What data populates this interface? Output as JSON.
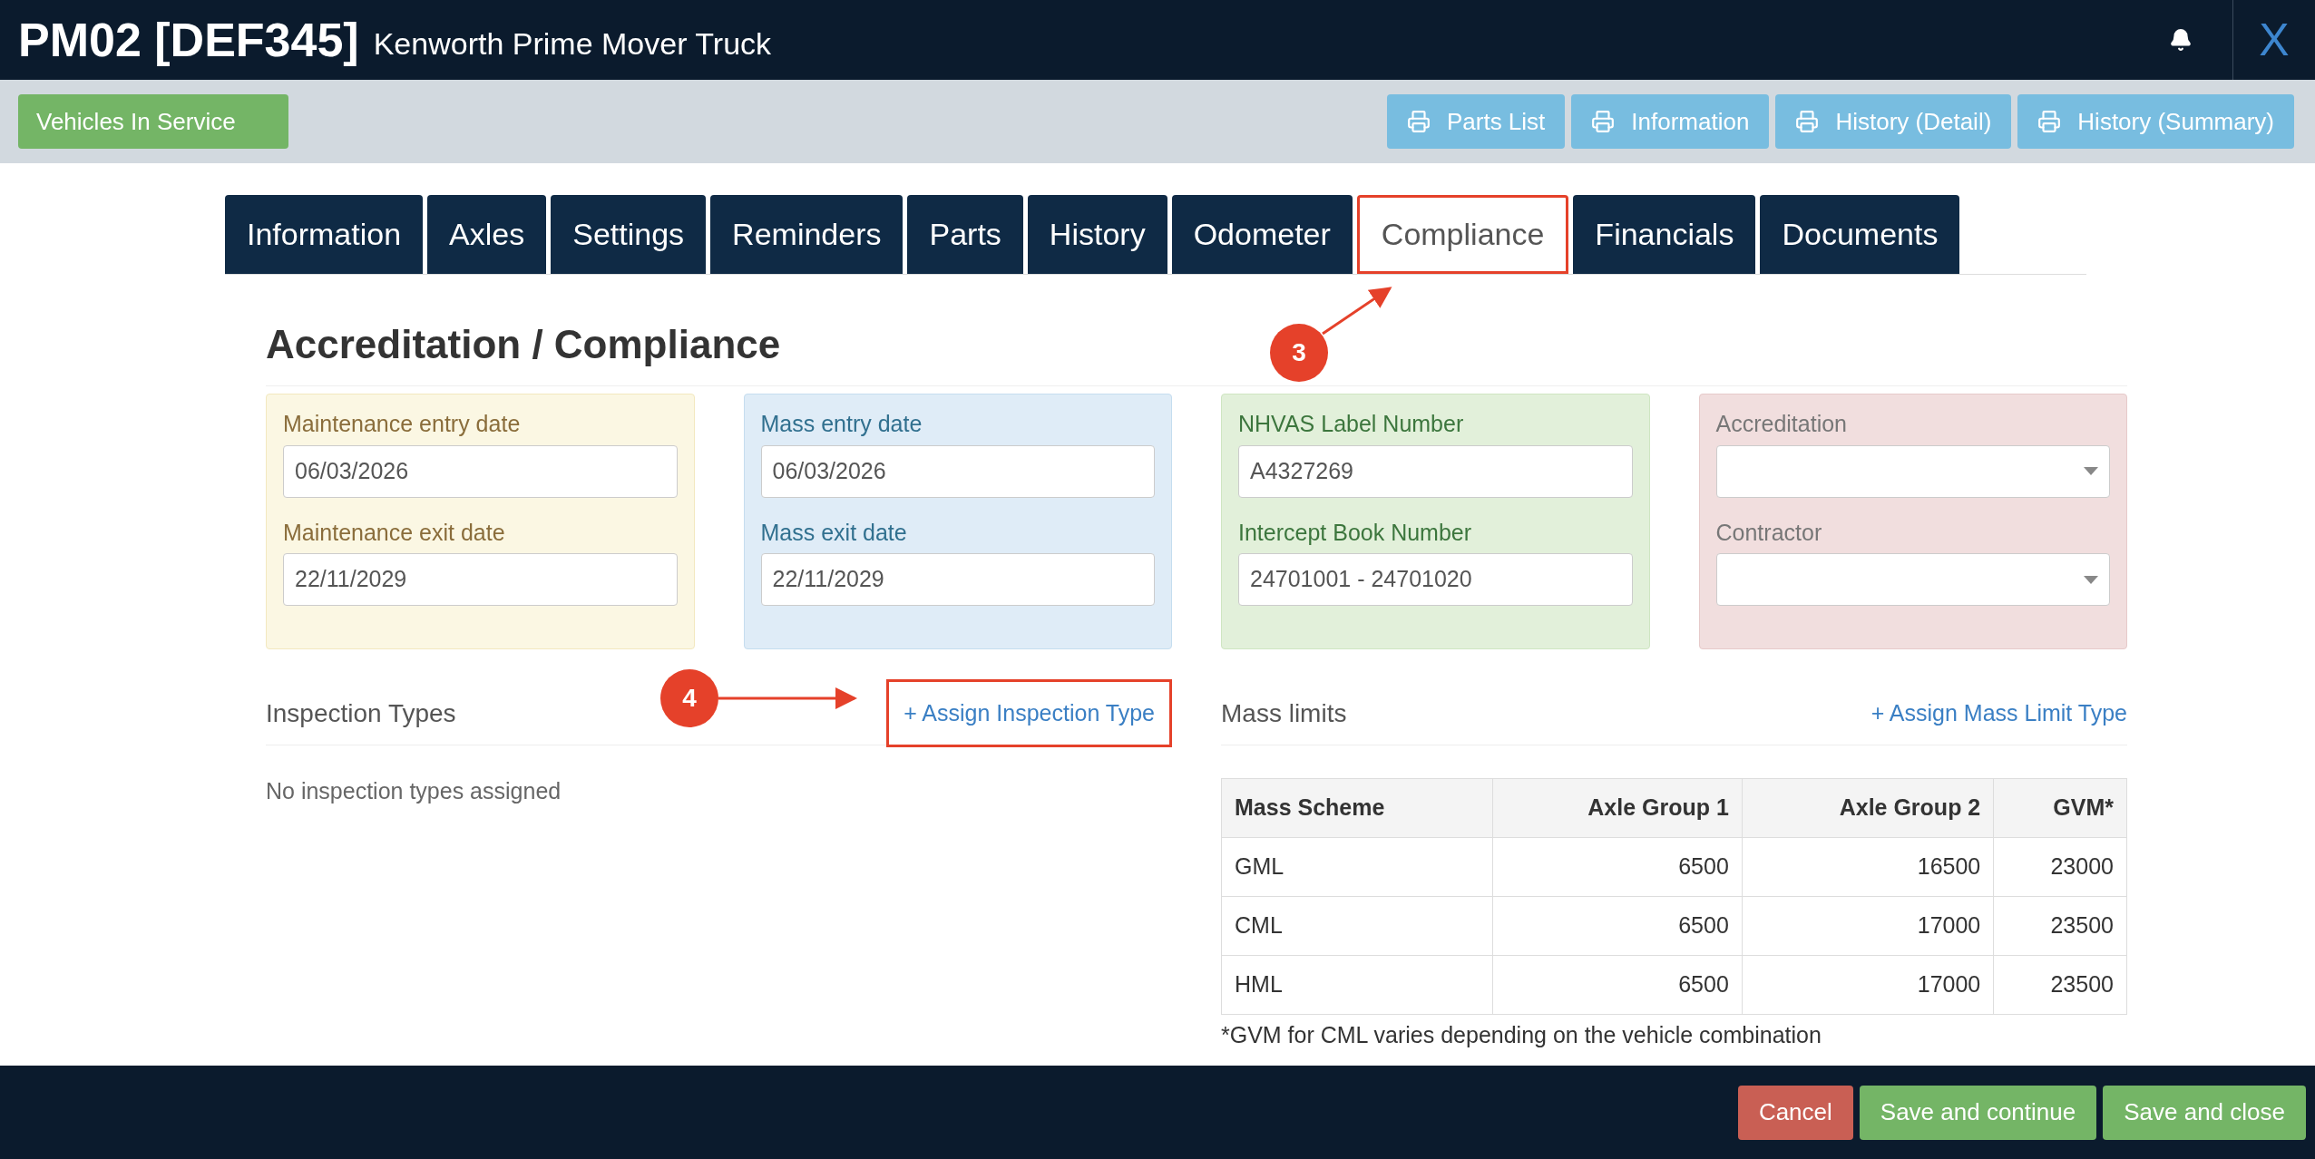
{
  "header": {
    "title": "PM02 [DEF345]",
    "subtitle": "Kenworth Prime Mover Truck",
    "close": "X"
  },
  "toolbar": {
    "status_button": "Vehicles In Service",
    "print_buttons": [
      "Parts List",
      "Information",
      "History (Detail)",
      "History (Summary)"
    ]
  },
  "tabs": [
    {
      "label": "Information",
      "selected": false,
      "outlined": false
    },
    {
      "label": "Axles",
      "selected": false,
      "outlined": false
    },
    {
      "label": "Settings",
      "selected": false,
      "outlined": false
    },
    {
      "label": "Reminders",
      "selected": false,
      "outlined": false
    },
    {
      "label": "Parts",
      "selected": false,
      "outlined": false
    },
    {
      "label": "History",
      "selected": false,
      "outlined": false
    },
    {
      "label": "Odometer",
      "selected": false,
      "outlined": false
    },
    {
      "label": "Compliance",
      "selected": true,
      "outlined": true
    },
    {
      "label": "Financials",
      "selected": false,
      "outlined": false
    },
    {
      "label": "Documents",
      "selected": false,
      "outlined": false
    }
  ],
  "heading": "Accreditation / Compliance",
  "panels": [
    {
      "kind": "warning",
      "fields": [
        {
          "label": "Maintenance entry date",
          "kind": "text",
          "value": "06/03/2026"
        },
        {
          "label": "Maintenance exit date",
          "kind": "text",
          "value": "22/11/2029"
        }
      ]
    },
    {
      "kind": "info",
      "fields": [
        {
          "label": "Mass entry date",
          "kind": "text",
          "value": "06/03/2026"
        },
        {
          "label": "Mass exit date",
          "kind": "text",
          "value": "22/11/2029"
        }
      ]
    },
    {
      "kind": "success",
      "fields": [
        {
          "label": "NHVAS Label Number",
          "kind": "text",
          "value": "A4327269"
        },
        {
          "label": "Intercept Book Number",
          "kind": "text",
          "value": "24701001 - 24701020"
        }
      ]
    },
    {
      "kind": "danger",
      "fields": [
        {
          "label": "Accreditation",
          "kind": "select"
        },
        {
          "label": "Contractor",
          "kind": "select"
        }
      ]
    }
  ],
  "inspection": {
    "title": "Inspection Types",
    "link": "+ Assign Inspection Type",
    "link_outlined": true,
    "empty_text": "No inspection types assigned"
  },
  "mass_limits": {
    "title": "Mass limits",
    "link": "+ Assign Mass Limit Type",
    "columns": [
      "Mass Scheme",
      "Axle Group 1",
      "Axle Group 2",
      "GVM*"
    ],
    "rows": [
      [
        "GML",
        "6500",
        "16500",
        "23000"
      ],
      [
        "CML",
        "6500",
        "17000",
        "23500"
      ],
      [
        "HML",
        "6500",
        "17000",
        "23500"
      ]
    ],
    "footnote": "*GVM for CML varies depending on the vehicle combination"
  },
  "callouts": [
    {
      "kind": "tab",
      "number": "3"
    },
    {
      "kind": "link",
      "number": "4"
    }
  ],
  "footer_buttons": [
    {
      "label": "Cancel",
      "kind": "danger"
    },
    {
      "label": "Save and continue",
      "kind": "success"
    },
    {
      "label": "Save and close",
      "kind": "success"
    }
  ]
}
